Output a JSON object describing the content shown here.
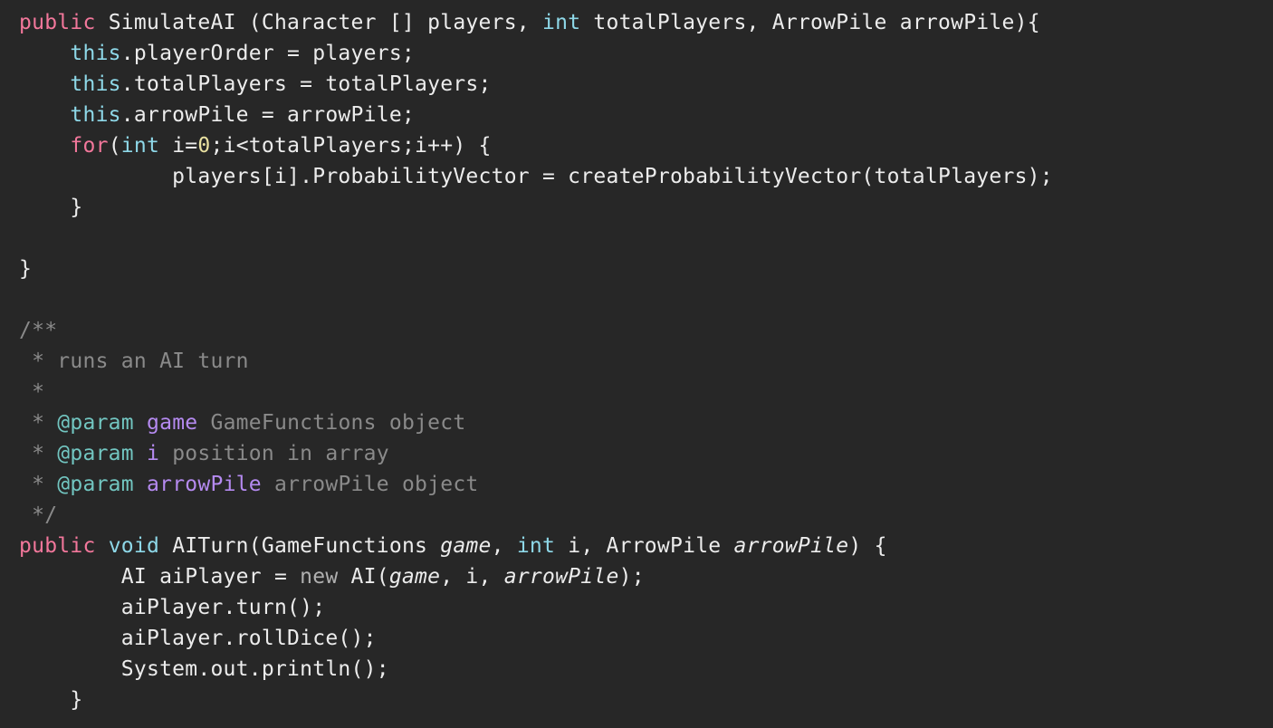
{
  "editor": {
    "language": "java",
    "colors": {
      "background": "#272727",
      "text": "#ececec",
      "keyword": "#f2779b",
      "type": "#8ed8e8",
      "number": "#e8e0a0",
      "comment": "#8a8a8a",
      "javadoc_tag": "#72c6c1",
      "javadoc_param": "#b58af0"
    },
    "lines": [
      [
        {
          "t": "public",
          "c": "kw-pink"
        },
        {
          "t": " SimulateAI (Character [] players, "
        },
        {
          "t": "int",
          "c": "kw-cyan"
        },
        {
          "t": " totalPlayers, ArrowPile arrowPile){"
        }
      ],
      [
        {
          "t": "    "
        },
        {
          "t": "this",
          "c": "kw-cyan"
        },
        {
          "t": ".playerOrder = players;"
        }
      ],
      [
        {
          "t": "    "
        },
        {
          "t": "this",
          "c": "kw-cyan"
        },
        {
          "t": ".totalPlayers = totalPlayers;"
        }
      ],
      [
        {
          "t": "    "
        },
        {
          "t": "this",
          "c": "kw-cyan"
        },
        {
          "t": ".arrowPile = arrowPile;"
        }
      ],
      [
        {
          "t": "    "
        },
        {
          "t": "for",
          "c": "kw-pink"
        },
        {
          "t": "("
        },
        {
          "t": "int",
          "c": "kw-cyan"
        },
        {
          "t": " i="
        },
        {
          "t": "0",
          "c": "num"
        },
        {
          "t": ";i<totalPlayers;i++) {"
        }
      ],
      [
        {
          "t": "            players[i].ProbabilityVector = createProbabilityVector(totalPlayers);"
        }
      ],
      [
        {
          "t": "    }"
        }
      ],
      [
        {
          "t": ""
        }
      ],
      [
        {
          "t": "}"
        }
      ],
      [
        {
          "t": ""
        }
      ],
      [
        {
          "t": "/**",
          "c": "cm"
        }
      ],
      [
        {
          "t": " * runs an AI turn",
          "c": "cm"
        }
      ],
      [
        {
          "t": " *",
          "c": "cm"
        }
      ],
      [
        {
          "t": " * ",
          "c": "cm"
        },
        {
          "t": "@param",
          "c": "tag"
        },
        {
          "t": " "
        },
        {
          "t": "game",
          "c": "param"
        },
        {
          "t": " GameFunctions object",
          "c": "cm"
        }
      ],
      [
        {
          "t": " * ",
          "c": "cm"
        },
        {
          "t": "@param",
          "c": "tag"
        },
        {
          "t": " "
        },
        {
          "t": "i",
          "c": "param"
        },
        {
          "t": " position in array",
          "c": "cm"
        }
      ],
      [
        {
          "t": " * ",
          "c": "cm"
        },
        {
          "t": "@param",
          "c": "tag"
        },
        {
          "t": " "
        },
        {
          "t": "arrowPile",
          "c": "param"
        },
        {
          "t": " arrowPile object",
          "c": "cm"
        }
      ],
      [
        {
          "t": " */",
          "c": "cm"
        }
      ],
      [
        {
          "t": "public",
          "c": "kw-pink"
        },
        {
          "t": " "
        },
        {
          "t": "void",
          "c": "kw-cyan"
        },
        {
          "t": " AITurn(GameFunctions "
        },
        {
          "t": "game",
          "c": "it"
        },
        {
          "t": ", "
        },
        {
          "t": "int",
          "c": "kw-cyan"
        },
        {
          "t": " i, ArrowPile "
        },
        {
          "t": "arrowPile",
          "c": "it"
        },
        {
          "t": ") {"
        }
      ],
      [
        {
          "t": "        AI aiPlayer = "
        },
        {
          "t": "new",
          "c": "new-kw"
        },
        {
          "t": " AI("
        },
        {
          "t": "game",
          "c": "it"
        },
        {
          "t": ", i, "
        },
        {
          "t": "arrowPile",
          "c": "it"
        },
        {
          "t": ");"
        }
      ],
      [
        {
          "t": "        aiPlayer.turn();"
        }
      ],
      [
        {
          "t": "        aiPlayer.rollDice();"
        }
      ],
      [
        {
          "t": "        System.out.println();"
        }
      ],
      [
        {
          "t": "    }"
        }
      ]
    ]
  }
}
